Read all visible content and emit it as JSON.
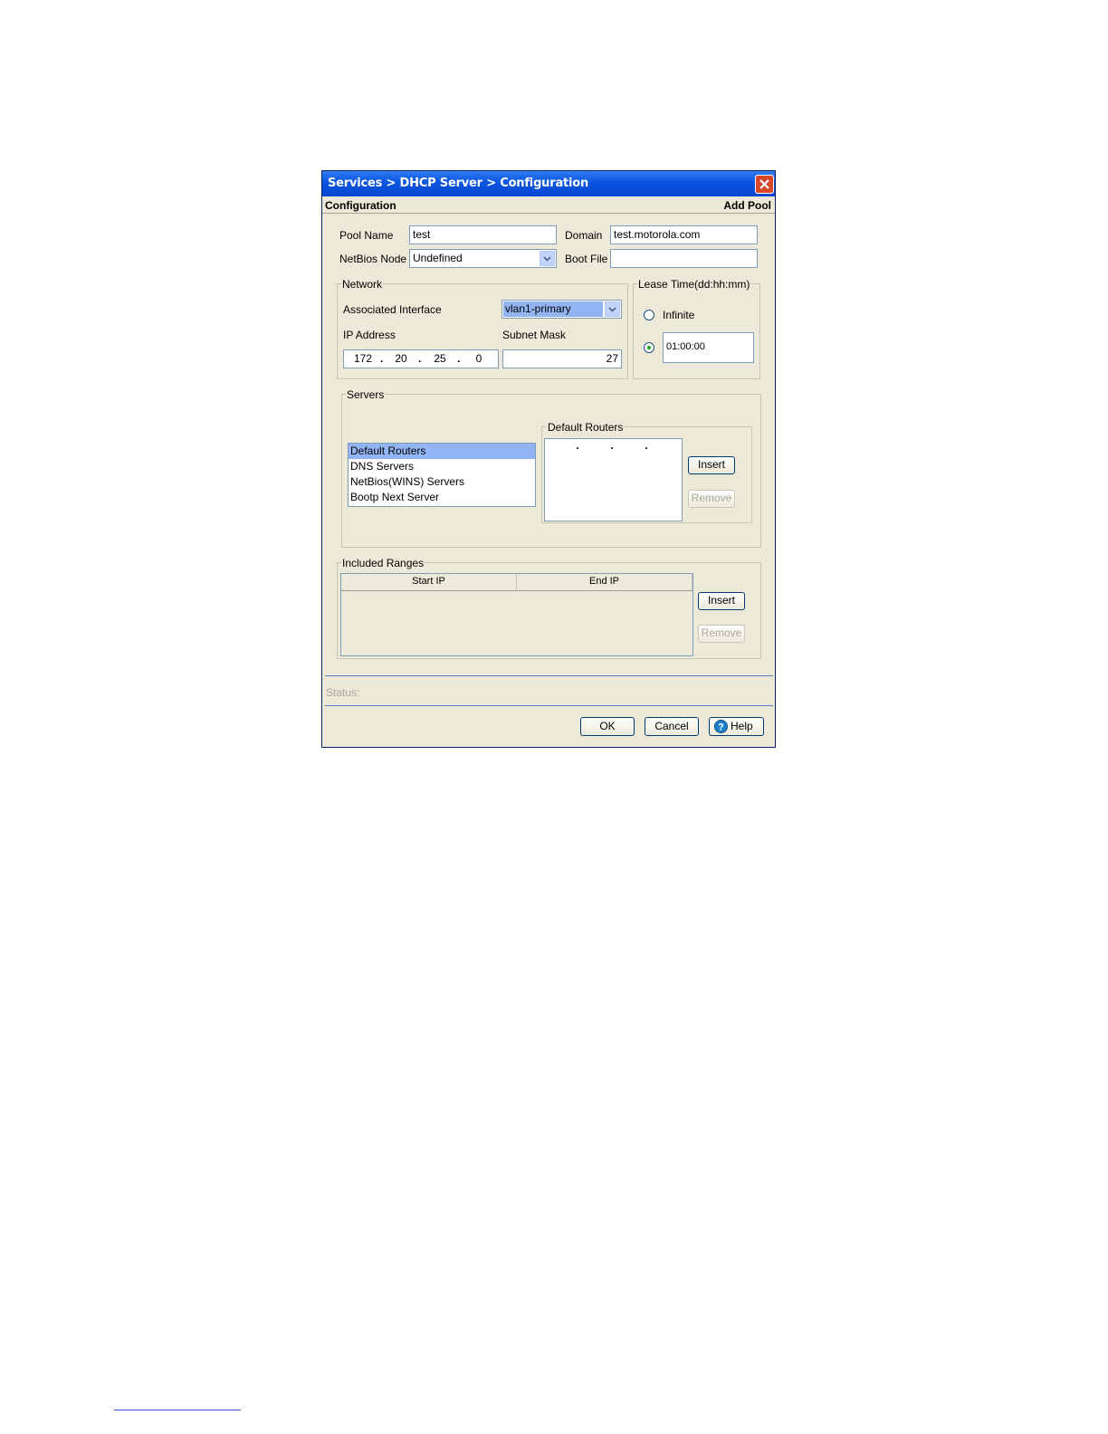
{
  "window": {
    "title": "Services > DHCP Server > Configuration",
    "section_title": "Configuration",
    "mode_label": "Add Pool"
  },
  "form": {
    "pool_name_label": "Pool Name",
    "pool_name_value": "test",
    "domain_label": "Domain",
    "domain_value": "test.motorola.com",
    "netbios_node_label": "NetBios Node",
    "netbios_node_value": "Undefined",
    "boot_file_label": "Boot File",
    "boot_file_value": ""
  },
  "network": {
    "legend": "Network",
    "assoc_interface_label": "Associated Interface",
    "assoc_interface_value": "vlan1-primary",
    "ip_label": "IP Address",
    "ip_octets": [
      "172",
      "20",
      "25",
      "0"
    ],
    "subnet_label": "Subnet Mask",
    "subnet_value": "27"
  },
  "lease": {
    "legend": "Lease Time(dd:hh:mm)",
    "infinite_label": "Infinite",
    "infinite_selected": false,
    "time_value": "01:00:00",
    "time_selected": true
  },
  "servers": {
    "legend": "Servers",
    "types": [
      "Default Routers",
      "DNS Servers",
      "NetBios(WINS) Servers",
      "Bootp Next Server"
    ],
    "selected_index": 0,
    "detail_legend": "Default Routers",
    "insert_label": "Insert",
    "remove_label": "Remove"
  },
  "ranges": {
    "legend": "Included Ranges",
    "columns": [
      "Start IP",
      "End IP"
    ],
    "rows": [],
    "insert_label": "Insert",
    "remove_label": "Remove"
  },
  "status": {
    "label": "Status:"
  },
  "buttons": {
    "ok": "OK",
    "cancel": "Cancel",
    "help": "Help"
  },
  "colors": {
    "dialog_bg": "#ece9d8",
    "titlebar": "#0a55e0",
    "selection": "#92b4f2"
  }
}
